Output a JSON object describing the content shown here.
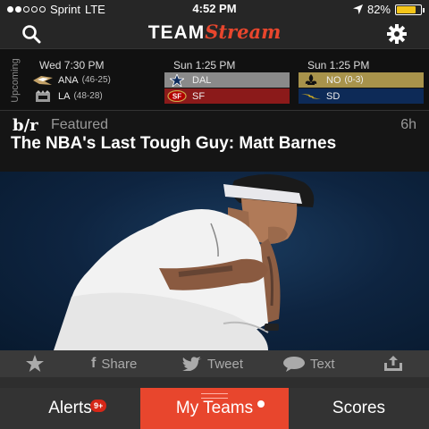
{
  "status_bar": {
    "carrier": "Sprint",
    "network": "LTE",
    "time": "4:52 PM",
    "battery_percent": "82%",
    "battery_level": 0.82,
    "signal_bars_filled": 2,
    "signal_bars_total": 5
  },
  "nav": {
    "logo_team": "TEAM",
    "logo_stream": "Stream",
    "search_icon": "search-icon",
    "settings_icon": "gear-icon",
    "accent_color": "#e8462d"
  },
  "upcoming": {
    "label": "Upcoming",
    "games": [
      {
        "time": "Wed 7:30 PM",
        "teams": [
          {
            "abbr": "ANA",
            "record": "(46-25)",
            "color": "#111111"
          },
          {
            "abbr": "LA",
            "record": "(48-28)",
            "color": "#111111"
          }
        ]
      },
      {
        "time": "Sun 1:25 PM",
        "teams": [
          {
            "abbr": "DAL",
            "record": "",
            "color": "#8a8a8a"
          },
          {
            "abbr": "SF",
            "record": "",
            "color": "#8b1a1a"
          }
        ]
      },
      {
        "time": "Sun 1:25 PM",
        "teams": [
          {
            "abbr": "NO",
            "record": "(0-3)",
            "color": "#a8934b"
          },
          {
            "abbr": "SD",
            "record": "",
            "color": "#0d2a57"
          }
        ]
      }
    ]
  },
  "featured": {
    "source_logo": "b/r",
    "label": "Featured",
    "age": "6h",
    "title": "The NBA's Last Tough Guy: Matt Barnes"
  },
  "share_bar": {
    "favorite_icon": "star-icon",
    "facebook_label": "Share",
    "twitter_label": "Tweet",
    "text_label": "Text",
    "export_icon": "share-export-icon"
  },
  "tabs": {
    "alerts": "Alerts",
    "alerts_badge": "9+",
    "my_teams": "My Teams",
    "scores": "Scores"
  }
}
